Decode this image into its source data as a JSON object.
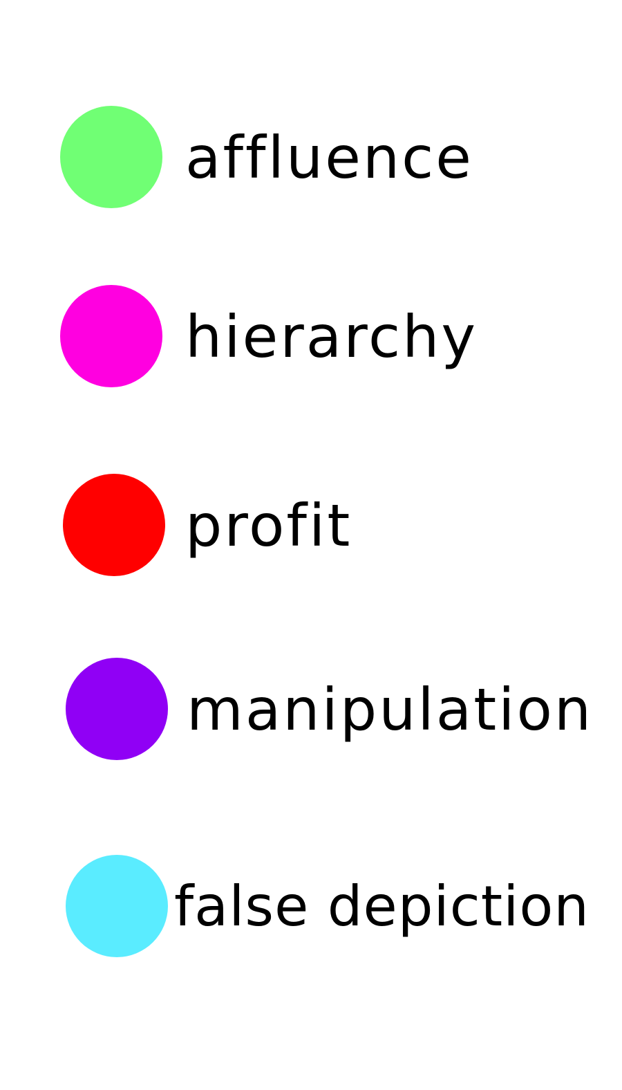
{
  "legend": {
    "items": [
      {
        "label": "affluence",
        "color": "#70ff74"
      },
      {
        "label": "hierarchy",
        "color": "#ff00e0"
      },
      {
        "label": "profit",
        "color": "#ff0000"
      },
      {
        "label": "manipulation",
        "color": "#9000f5"
      },
      {
        "label": "false depiction",
        "color": "#5aecff"
      }
    ]
  }
}
